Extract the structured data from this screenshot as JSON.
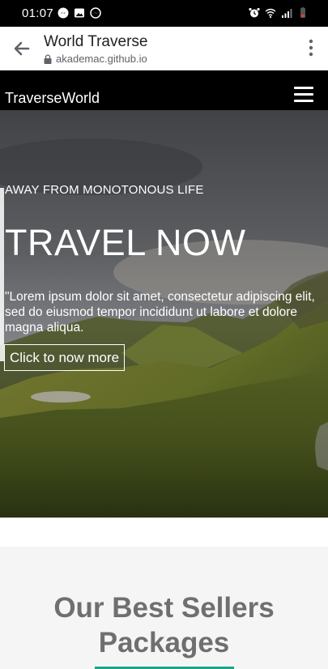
{
  "status_bar": {
    "time": "01:07",
    "left_icons": [
      "messenger-icon",
      "gallery-icon",
      "messenger-icon"
    ],
    "right_icons": [
      "alarm-icon",
      "wifi-icon",
      "signal-icon",
      "battery-low-icon"
    ],
    "battery_color": "#e53935"
  },
  "browser": {
    "title": "World Traverse",
    "url": "akademac.github.io",
    "icons": [
      "back-arrow-icon",
      "lock-icon",
      "more-vert-icon"
    ]
  },
  "site_nav": {
    "brand": "TraverseWorld",
    "menu_icon": "hamburger-menu-icon"
  },
  "hero": {
    "eyebrow": "AWAY FROM MONOTONOUS LIFE",
    "headline": "TRAVEL NOW",
    "lede": "\"Lorem ipsum dolor sit amet, consectetur adipiscing elit, sed do eiusmod tempor incididunt ut labore et dolore magna aliqua.",
    "cta_label": "Click to now more"
  },
  "section": {
    "title_line1": "Our Best Sellers",
    "title_line2": "Packages",
    "accent_color": "#1aa589"
  }
}
